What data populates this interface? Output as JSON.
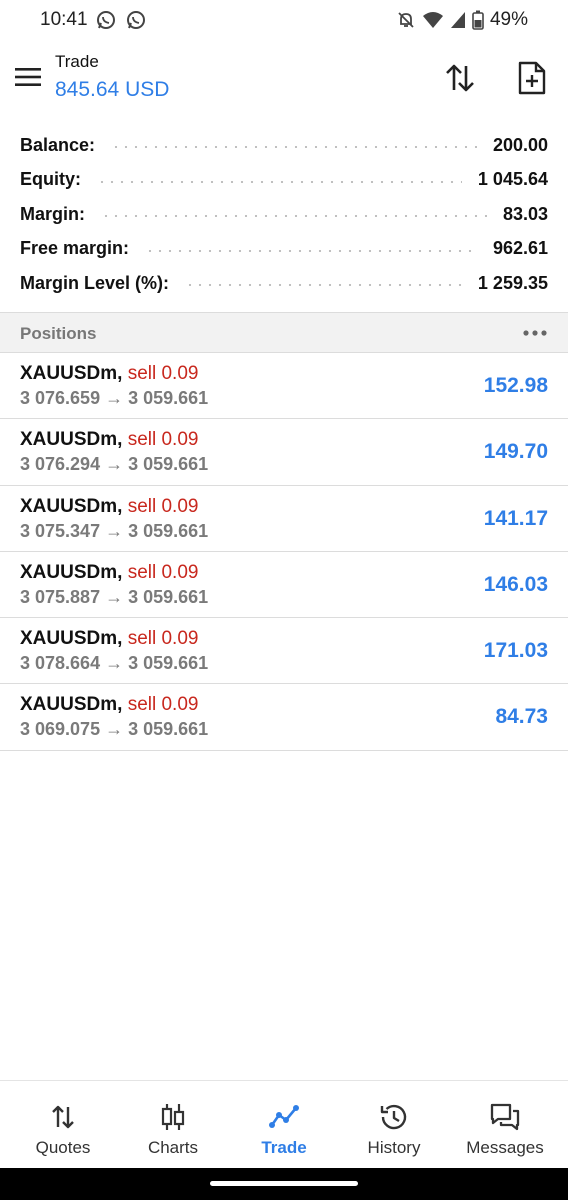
{
  "status_bar": {
    "time": "10:41",
    "battery": "49%",
    "icons": [
      "whatsapp-icon",
      "whatsapp-icon",
      "mute-icon",
      "wifi-icon",
      "signal-icon",
      "battery-icon"
    ]
  },
  "header": {
    "title": "Trade",
    "equity_display": "845.64 USD",
    "icons": [
      "menu-icon",
      "sort-icon",
      "new-order-icon"
    ]
  },
  "summary": [
    {
      "label": "Balance:",
      "value": "200.00"
    },
    {
      "label": "Equity:",
      "value": "1 045.64"
    },
    {
      "label": "Margin:",
      "value": "83.03"
    },
    {
      "label": "Free margin:",
      "value": "962.61"
    },
    {
      "label": "Margin Level (%):",
      "value": "1 259.35"
    }
  ],
  "positions_section": {
    "title": "Positions",
    "more_icon": "more-horizontal-icon"
  },
  "positions": [
    {
      "symbol": "XAUUSDm,",
      "side": "sell 0.09",
      "prices": "3 076.659 → 3 059.661",
      "profit": "152.98"
    },
    {
      "symbol": "XAUUSDm,",
      "side": "sell 0.09",
      "prices": "3 076.294 → 3 059.661",
      "profit": "149.70"
    },
    {
      "symbol": "XAUUSDm,",
      "side": "sell 0.09",
      "prices": "3 075.347 → 3 059.661",
      "profit": "141.17"
    },
    {
      "symbol": "XAUUSDm,",
      "side": "sell 0.09",
      "prices": "3 075.887 → 3 059.661",
      "profit": "146.03"
    },
    {
      "symbol": "XAUUSDm,",
      "side": "sell 0.09",
      "prices": "3 078.664 → 3 059.661",
      "profit": "171.03"
    },
    {
      "symbol": "XAUUSDm,",
      "side": "sell 0.09",
      "prices": "3 069.075 → 3 059.661",
      "profit": "84.73"
    }
  ],
  "bottom_nav": [
    {
      "label": "Quotes",
      "icon": "quotes-icon",
      "active": false
    },
    {
      "label": "Charts",
      "icon": "charts-icon",
      "active": false
    },
    {
      "label": "Trade",
      "icon": "trade-icon",
      "active": true
    },
    {
      "label": "History",
      "icon": "history-icon",
      "active": false
    },
    {
      "label": "Messages",
      "icon": "messages-icon",
      "active": false
    }
  ],
  "colors": {
    "accent": "#2f7ee6",
    "sell": "#c8281e",
    "muted": "#7a7a7a",
    "section_bg": "#f2f2f2"
  }
}
